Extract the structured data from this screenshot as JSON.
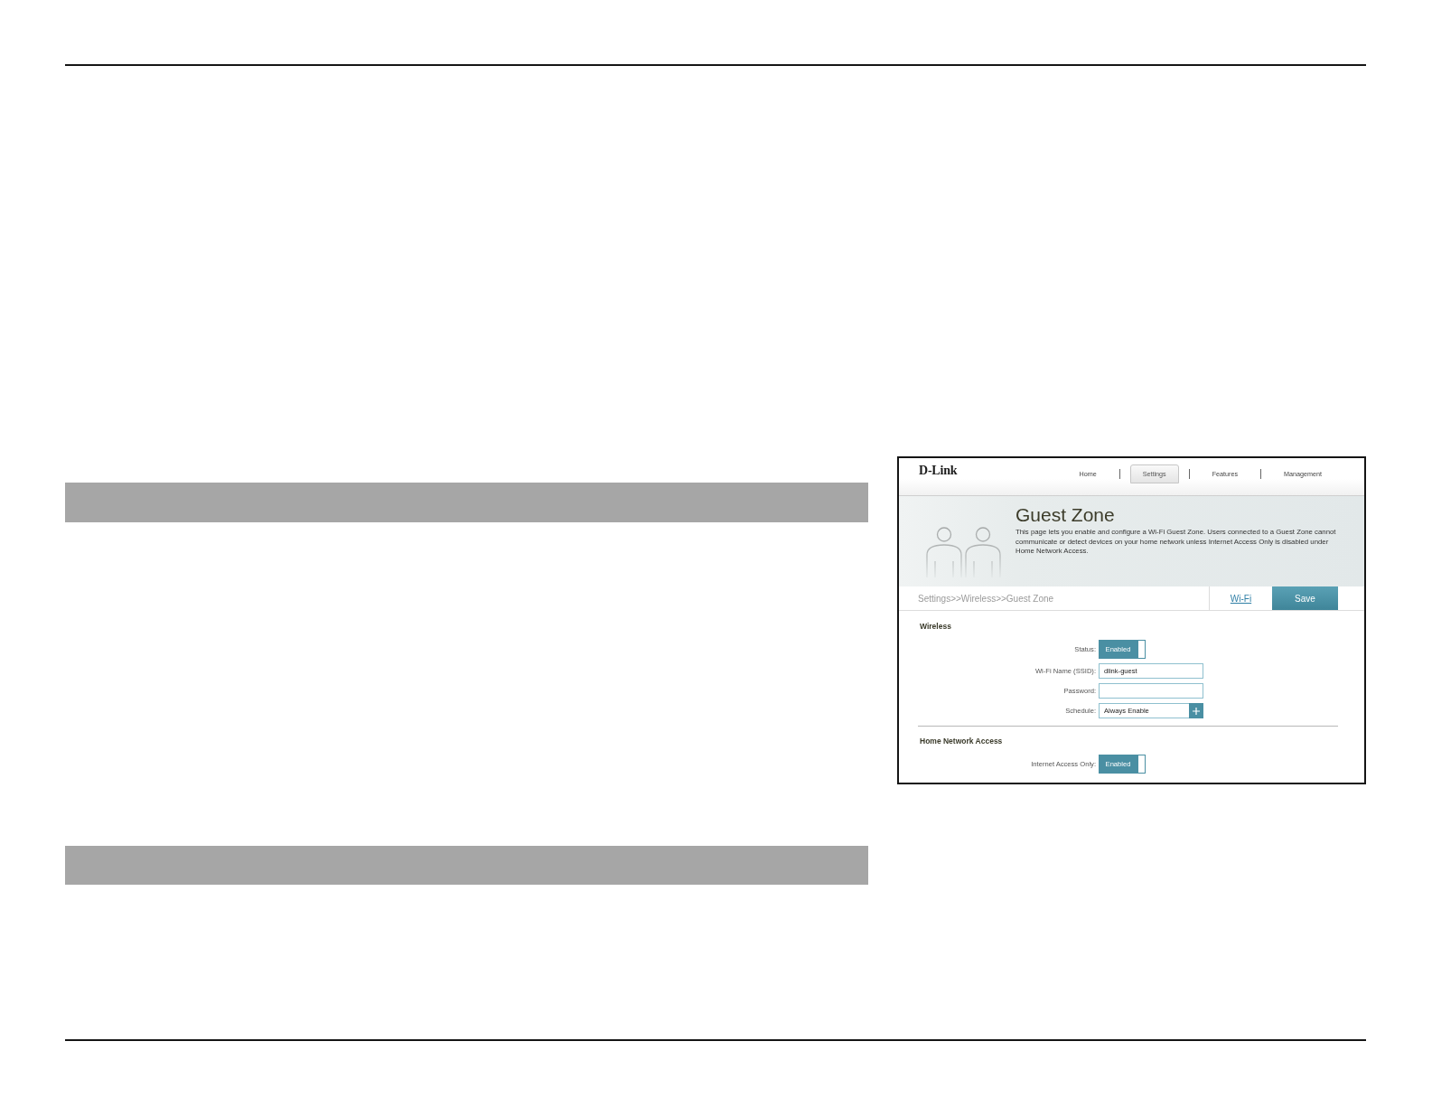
{
  "router_screenshot": {
    "logo": "D-Link",
    "nav": [
      {
        "label": "Home",
        "selected": false
      },
      {
        "label": "Settings",
        "selected": true
      },
      {
        "label": "Features",
        "selected": false
      },
      {
        "label": "Management",
        "selected": false
      }
    ],
    "title": "Guest Zone",
    "description": "This page lets you enable and configure a Wi-Fi Guest Zone. Users connected to a Guest Zone cannot communicate or detect devices on your home network unless Internet Access Only is disabled under Home Network Access.",
    "breadcrumb": "Settings>>Wireless>>Guest Zone",
    "link": "Wi-Fi",
    "save_button": "Save",
    "sections": [
      {
        "title": "Wireless",
        "fields": [
          {
            "kind": "toggle",
            "label": "Status:",
            "value": "Enabled",
            "on": true
          },
          {
            "kind": "text",
            "label": "Wi-Fi Name (SSID):",
            "value": "dlink-guest"
          },
          {
            "kind": "password",
            "label": "Password:"
          },
          {
            "kind": "select",
            "label": "Schedule:",
            "value": "Always Enable"
          }
        ]
      },
      {
        "title": "Home Network Access",
        "fields": [
          {
            "kind": "toggle",
            "label": "Internet Access Only:",
            "value": "Enabled",
            "on": true
          }
        ]
      }
    ]
  }
}
